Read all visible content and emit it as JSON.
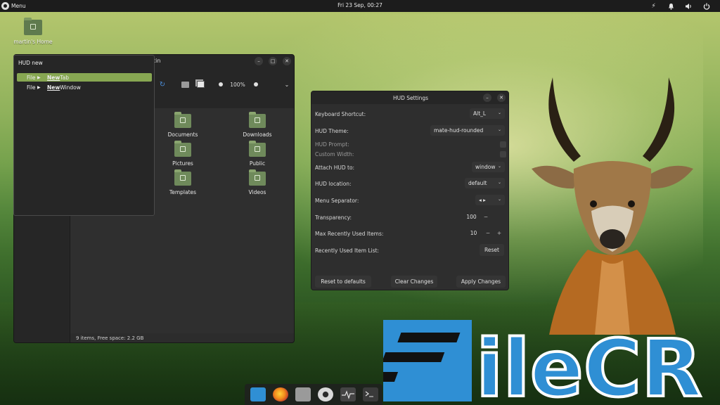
{
  "top_panel": {
    "menu_label": "Menu",
    "clock": "Fri 23 Sep, 00:27"
  },
  "desktop": {
    "home_label": "martin's Home"
  },
  "file_manager": {
    "title_partial": "tin",
    "zoom_level": "100%",
    "items": [
      {
        "label": "Documents"
      },
      {
        "label": "Downloads"
      },
      {
        "label": "Pictures"
      },
      {
        "label": "Public"
      },
      {
        "label": "Templates"
      },
      {
        "label": "Videos"
      }
    ],
    "status": "9 items, Free space: 2.2 GB"
  },
  "hud": {
    "query": "HUD  new",
    "results": [
      {
        "menu": "File",
        "match": "New",
        "rest": " Tab",
        "selected": true
      },
      {
        "menu": "File",
        "match": "New",
        "rest": " Window",
        "selected": false
      }
    ]
  },
  "hud_settings": {
    "title": "HUD Settings",
    "rows": {
      "keyboard_shortcut": {
        "label": "Keyboard Shortcut:",
        "value": "Alt_L"
      },
      "hud_theme": {
        "label": "HUD Theme:",
        "value": "mate-hud-rounded"
      },
      "hud_prompt": {
        "label": "HUD Prompt:"
      },
      "custom_width": {
        "label": "Custom Width:"
      },
      "attach_hud": {
        "label": "Attach HUD to:",
        "value": "window"
      },
      "hud_location": {
        "label": "HUD location:",
        "value": "default"
      },
      "menu_separator": {
        "label": "Menu Separator:",
        "value": "◂ ▸"
      },
      "transparency": {
        "label": "Transparency:",
        "value": "100",
        "minus": "−"
      },
      "max_recent": {
        "label": "Max Recently Used Items:",
        "value": "10",
        "minus": "−",
        "plus": "+"
      },
      "recent_list": {
        "label": "Recently Used Item List:",
        "button": "Reset"
      }
    },
    "buttons": {
      "reset_defaults": "Reset to defaults",
      "clear_changes": "Clear Changes",
      "apply_changes": "Apply Changes"
    }
  },
  "dock": {
    "icons": [
      "files-blue-icon",
      "firefox-icon",
      "file-manager-icon",
      "settings-icon",
      "system-monitor-icon",
      "terminal-icon"
    ]
  },
  "watermark": {
    "text": "FileCR"
  },
  "colors": {
    "accent_green": "#87a752",
    "folder_green": "#6f8a5b",
    "panel_bg": "#1c1c1c",
    "window_bg": "#2e2e2e",
    "watermark_blue": "#2f8fd4"
  }
}
